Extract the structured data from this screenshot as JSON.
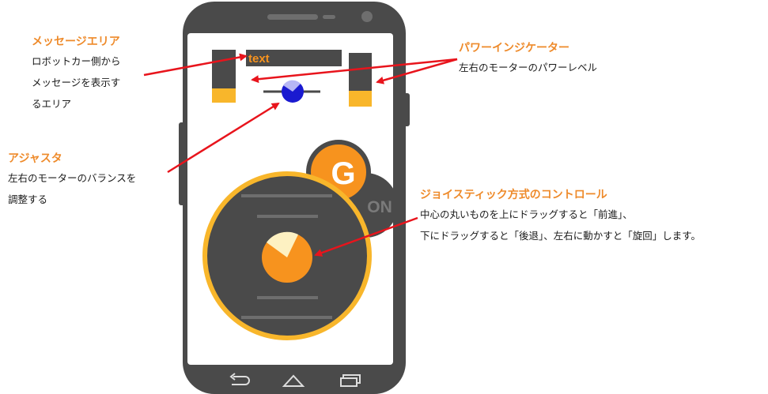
{
  "colors": {
    "phone_body": "#4a4a4a",
    "screen": "#ffffff",
    "accent_orange": "#f7931e",
    "ring_yellow": "#f8b62b",
    "adjuster_blue": "#1a1ad0",
    "arrow_red": "#e8141c",
    "title_orange": "#ee8a2a"
  },
  "phone": {
    "message_text": "text",
    "go_button_label": "G",
    "on_button_label": "ON",
    "left_power_level": 0.27,
    "right_power_level": 0.3,
    "nav_icons": [
      "back-icon",
      "home-icon",
      "recent-apps-icon"
    ]
  },
  "annotations": {
    "message_area": {
      "title": "メッセージエリア",
      "text": "ロボットカー側から\nメッセージを表示す\nるエリア"
    },
    "adjuster": {
      "title": "アジャスタ",
      "text": "左右のモーターのバランスを\n調整する"
    },
    "power_indicator": {
      "title": "パワーインジケーター",
      "text": "左右のモーターのパワーレベル"
    },
    "joystick": {
      "title": "ジョイスティック方式のコントロール",
      "text": "中心の丸いものを上にドラッグすると「前進」、\n下にドラッグすると「後退」、左右に動かすと「旋回」します。"
    }
  }
}
